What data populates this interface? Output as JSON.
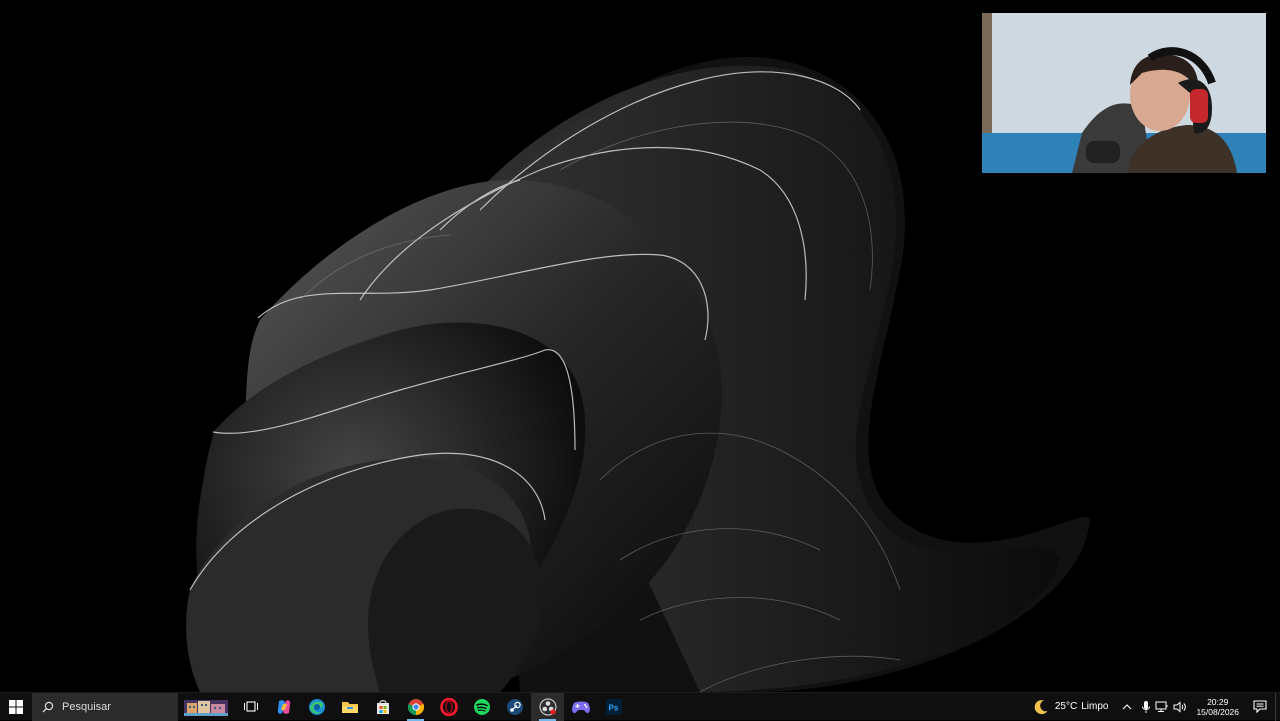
{
  "taskbar": {
    "search_placeholder": "Pesquisar",
    "pinned_apps": [
      {
        "name": "task-view-icon"
      },
      {
        "name": "copilot-icon"
      },
      {
        "name": "edge-icon"
      },
      {
        "name": "file-explorer-icon"
      },
      {
        "name": "microsoft-store-icon"
      },
      {
        "name": "chrome-icon"
      },
      {
        "name": "opera-icon"
      },
      {
        "name": "spotify-icon"
      },
      {
        "name": "steam-icon"
      },
      {
        "name": "obs-icon",
        "active": true
      },
      {
        "name": "game-controller-icon"
      },
      {
        "name": "photoshop-icon"
      }
    ]
  },
  "tray": {
    "weather_temp": "25°C",
    "weather_condition": "Limpo",
    "time": "20:29",
    "date": "15/08/2026"
  },
  "colors": {
    "taskbar_bg": "#0f0f0f",
    "accent": "#76b9ed",
    "wallpaper_bg": "#000000"
  }
}
